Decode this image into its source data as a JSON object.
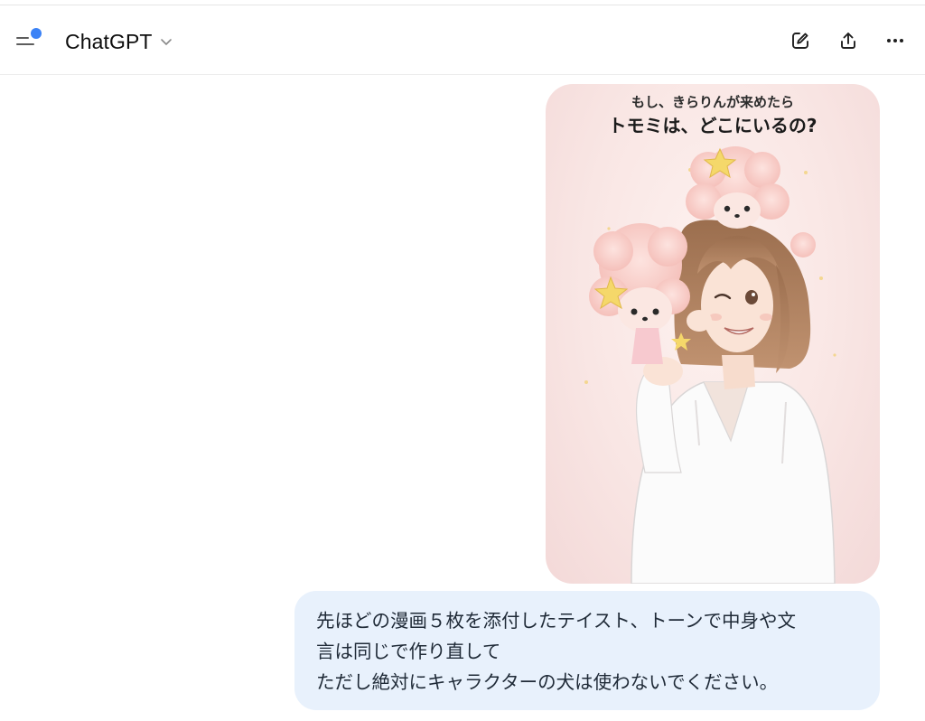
{
  "header": {
    "app_title": "ChatGPT",
    "icons": {
      "menu": "sidebar-toggle-icon",
      "new_chat": "edit-pencil-icon",
      "share": "share-upload-icon",
      "more": "more-dots-icon"
    },
    "notification_dot_color": "#3b82f6"
  },
  "message": {
    "image": {
      "subtitle": "もし、きらりんが来めたら",
      "title": "トモミは、どこにいるの?"
    },
    "text_lines": [
      "先ほどの漫画５枚を添付したテイスト、トーンで中身や文",
      "言は同じで作り直して",
      "ただし絶対にキャラクターの犬は使わないでください。"
    ],
    "bubble_color": "#e8f1fc"
  }
}
